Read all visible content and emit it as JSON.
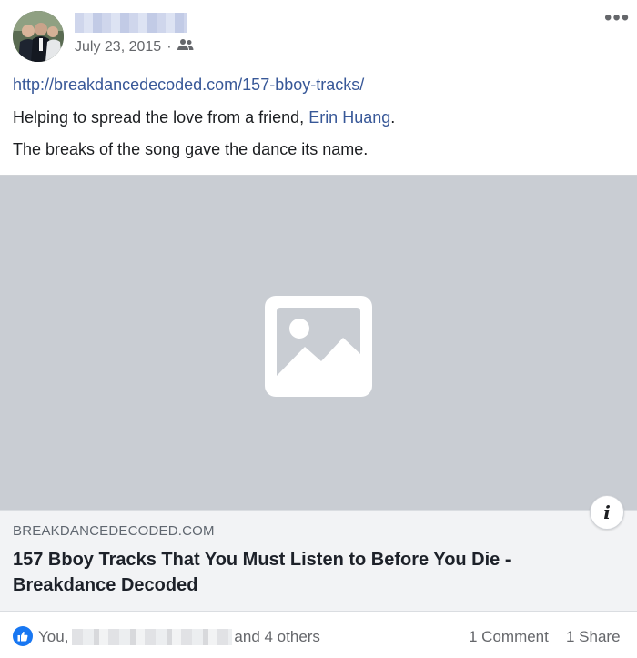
{
  "post": {
    "date": "July 23, 2015",
    "separator": "·",
    "audience_icon": "friends-icon",
    "menu_icon": "more-options-icon",
    "link_url": "http://breakdancedecoded.com/157-bboy-tracks/",
    "line1_prefix": "Helping to spread the love from a friend, ",
    "line1_mention": "Erin Huang",
    "line1_suffix": ".",
    "line2": "The breaks of the song gave the dance its name."
  },
  "media": {
    "placeholder_icon": "image-placeholder-icon",
    "info_icon": "info-icon",
    "info_label": "i"
  },
  "preview": {
    "domain": "BREAKDANCEDECODED.COM",
    "title": "157 Bboy Tracks That You Must Listen to Before You Die - Breakdance Decoded"
  },
  "footer": {
    "like_icon": "like-thumb-icon",
    "reaction_you": "You,",
    "reaction_others": "and 4 others",
    "comments": "1 Comment",
    "shares": "1 Share"
  },
  "colors": {
    "link": "#385898",
    "like_blue": "#1877f2",
    "secondary_text": "#65676b"
  }
}
